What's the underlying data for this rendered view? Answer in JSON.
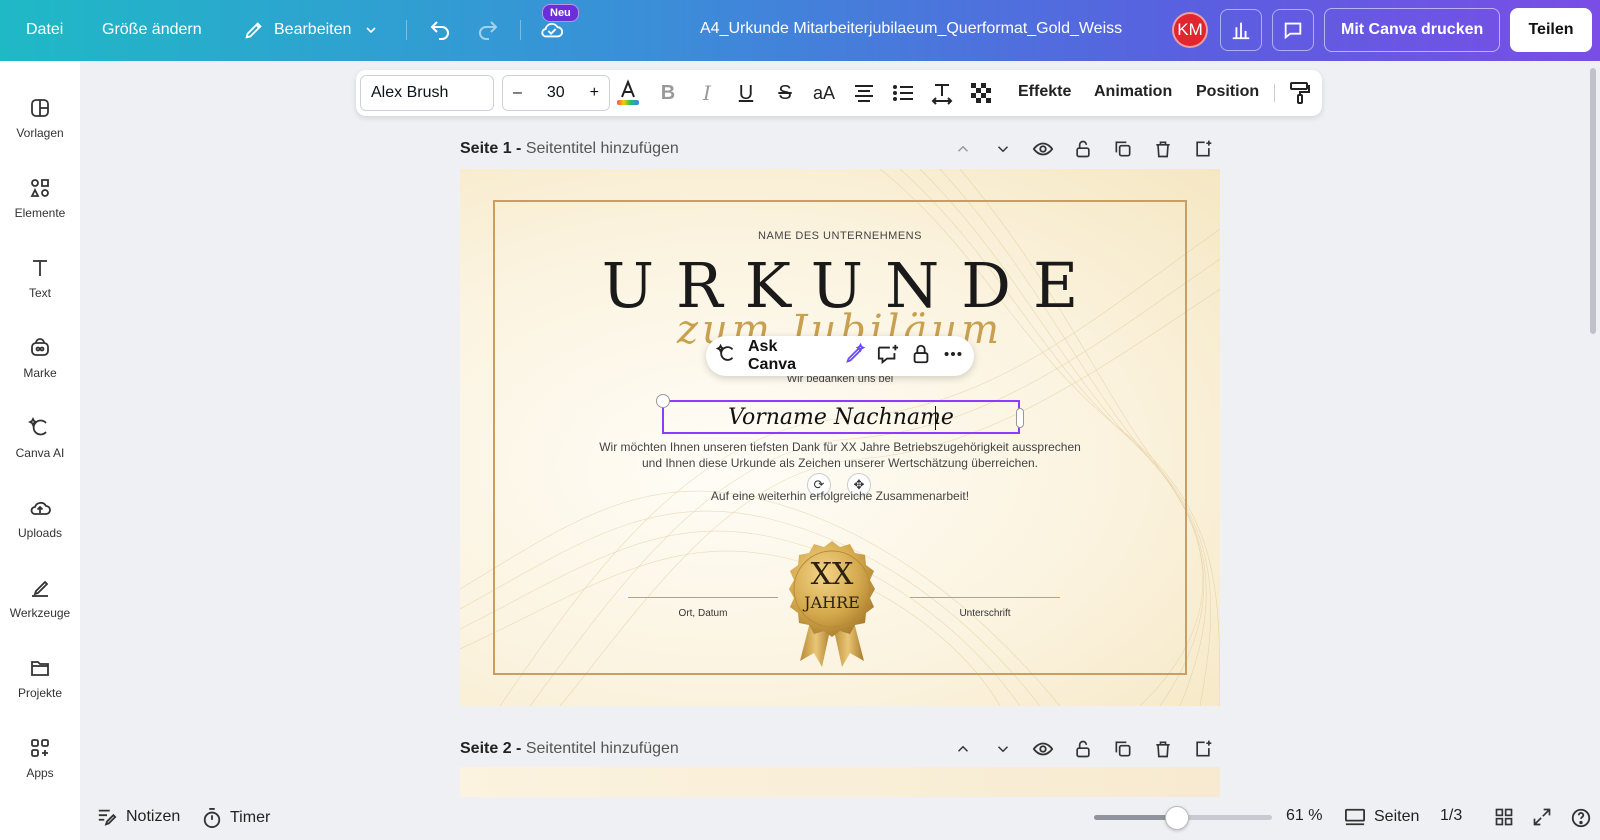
{
  "topbar": {
    "file": "Datei",
    "resize": "Größe ändern",
    "edit": "Bearbeiten",
    "new_badge": "Neu",
    "doc_title": "A4_Urkunde Mitarbeiterjubilaeum_Querformat_Gold_Weiss",
    "avatar_initials": "KM",
    "print": "Mit Canva drucken",
    "share": "Teilen"
  },
  "sidebar": {
    "items": [
      {
        "label": "Vorlagen",
        "icon": "templates-icon"
      },
      {
        "label": "Elemente",
        "icon": "elements-icon"
      },
      {
        "label": "Text",
        "icon": "text-icon"
      },
      {
        "label": "Marke",
        "icon": "brand-icon"
      },
      {
        "label": "Canva AI",
        "icon": "canva-ai-icon"
      },
      {
        "label": "Uploads",
        "icon": "upload-cloud-icon"
      },
      {
        "label": "Werkzeuge",
        "icon": "tools-icon"
      },
      {
        "label": "Projekte",
        "icon": "folder-icon"
      },
      {
        "label": "Apps",
        "icon": "apps-icon"
      }
    ]
  },
  "format_toolbar": {
    "font": "Alex Brush",
    "size_minus": "–",
    "size": "30",
    "size_plus": "+",
    "effects": "Effekte",
    "animation": "Animation",
    "position": "Position"
  },
  "pages": [
    {
      "label": "Seite 1 -",
      "title_placeholder": "Seitentitel hinzufügen"
    },
    {
      "label": "Seite 2 -",
      "title_placeholder": "Seitentitel hinzufügen"
    }
  ],
  "certificate": {
    "company": "NAME DES UNTERNEHMENS",
    "heading": "URKUNDE",
    "subheading": "zum Jubiläum",
    "thanks": "Wir bedanken uns bei",
    "name": "Vorname Nachname",
    "body_line1": "Wir möchten Ihnen unseren tiefsten Dank für XX Jahre Betriebszugehörigkeit aussprechen",
    "body_line2": "und Ihnen diese Urkunde als Zeichen unserer Wertschätzung überreichen.",
    "closing": "Auf eine weiterhin erfolgreiche Zusammenarbeit!",
    "place_date": "Ort, Datum",
    "signature": "Unterschrift",
    "seal_top": "XX",
    "seal_bottom": "JAHRE",
    "gold_color": "#c89e62"
  },
  "ask_canva": {
    "label": "Ask Canva"
  },
  "bottombar": {
    "notes": "Notizen",
    "timer": "Timer",
    "zoom": "61 %",
    "zoom_value": 61,
    "pages": "Seiten",
    "page_count": "1/3"
  },
  "colors": {
    "selection": "#8b3dff",
    "avatar": "#e0262f"
  }
}
